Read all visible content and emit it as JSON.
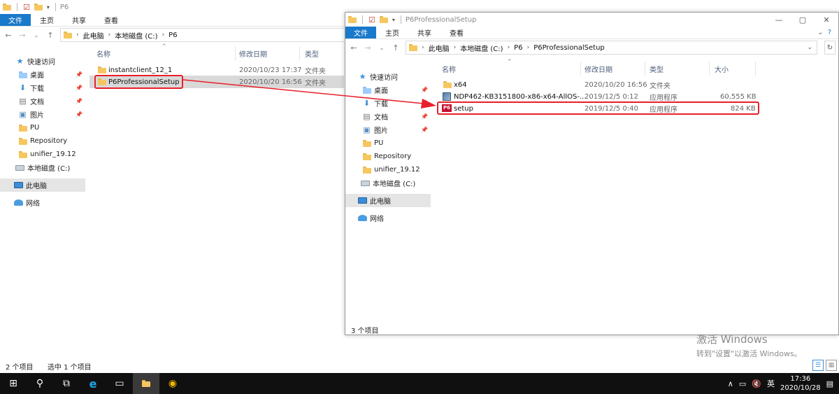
{
  "back_window": {
    "title": "P6",
    "ribbon_tabs": [
      "文件",
      "主页",
      "共享",
      "查看"
    ],
    "breadcrumb": [
      "此电脑",
      "本地磁盘 (C:)",
      "P6"
    ],
    "nav": [
      {
        "label": "快速访问",
        "icon": "star-icon"
      },
      {
        "label": "桌面",
        "icon": "desktop-icon",
        "pinned": true
      },
      {
        "label": "下载",
        "icon": "download-icon",
        "pinned": true
      },
      {
        "label": "文档",
        "icon": "document-icon",
        "pinned": true
      },
      {
        "label": "图片",
        "icon": "picture-icon",
        "pinned": true
      },
      {
        "label": "PU",
        "icon": "folder-icon"
      },
      {
        "label": "Repository",
        "icon": "folder-icon"
      },
      {
        "label": "unifier_19.12",
        "icon": "folder-icon"
      },
      {
        "label": "本地磁盘 (C:)",
        "icon": "drive-icon"
      },
      {
        "label": "此电脑",
        "icon": "computer-icon",
        "selected": true
      },
      {
        "label": "网络",
        "icon": "network-icon"
      }
    ],
    "columns": [
      "名称",
      "修改日期",
      "类型"
    ],
    "files": [
      {
        "name": "instantclient_12_1",
        "date": "2020/10/23 17:37",
        "type": "文件夹"
      },
      {
        "name": "P6ProfessionalSetup",
        "date": "2020/10/20 16:56",
        "type": "文件夹",
        "selected": true
      }
    ],
    "status_count": "2 个项目",
    "status_selected": "选中 1 个项目"
  },
  "front_window": {
    "title": "P6ProfessionalSetup",
    "ribbon_tabs": [
      "文件",
      "主页",
      "共享",
      "查看"
    ],
    "breadcrumb": [
      "此电脑",
      "本地磁盘 (C:)",
      "P6",
      "P6ProfessionalSetup"
    ],
    "nav": [
      {
        "label": "快速访问",
        "icon": "star-icon"
      },
      {
        "label": "桌面",
        "icon": "desktop-icon",
        "pinned": true
      },
      {
        "label": "下载",
        "icon": "download-icon",
        "pinned": true
      },
      {
        "label": "文档",
        "icon": "document-icon",
        "pinned": true
      },
      {
        "label": "图片",
        "icon": "picture-icon",
        "pinned": true
      },
      {
        "label": "PU",
        "icon": "folder-icon"
      },
      {
        "label": "Repository",
        "icon": "folder-icon"
      },
      {
        "label": "unifier_19.12",
        "icon": "folder-icon"
      },
      {
        "label": "本地磁盘 (C:)",
        "icon": "drive-icon"
      },
      {
        "label": "此电脑",
        "icon": "computer-icon",
        "selected": true
      },
      {
        "label": "网络",
        "icon": "network-icon"
      }
    ],
    "columns": [
      "名称",
      "修改日期",
      "类型",
      "大小"
    ],
    "files": [
      {
        "name": "x64",
        "date": "2020/10/20 16:56",
        "type": "文件夹",
        "size": "",
        "icon": "folder-icon"
      },
      {
        "name": "NDP462-KB3151800-x86-x64-AllOS-...",
        "date": "2019/12/5 0:12",
        "type": "应用程序",
        "size": "60,555 KB",
        "icon": "installer-icon"
      },
      {
        "name": "setup",
        "date": "2019/12/5 0:40",
        "type": "应用程序",
        "size": "824 KB",
        "icon": "p6-app-icon",
        "icon_text": "P6"
      }
    ],
    "status_count": "3 个项目"
  },
  "watermark": {
    "line1": "激活 Windows",
    "line2": "转到\"设置\"以激活 Windows。"
  },
  "taskbar": {
    "ime": "英",
    "time": "17:36",
    "date": "2020/10/28"
  },
  "colors": {
    "accent": "#1979ca",
    "highlight": "#e8202a"
  }
}
